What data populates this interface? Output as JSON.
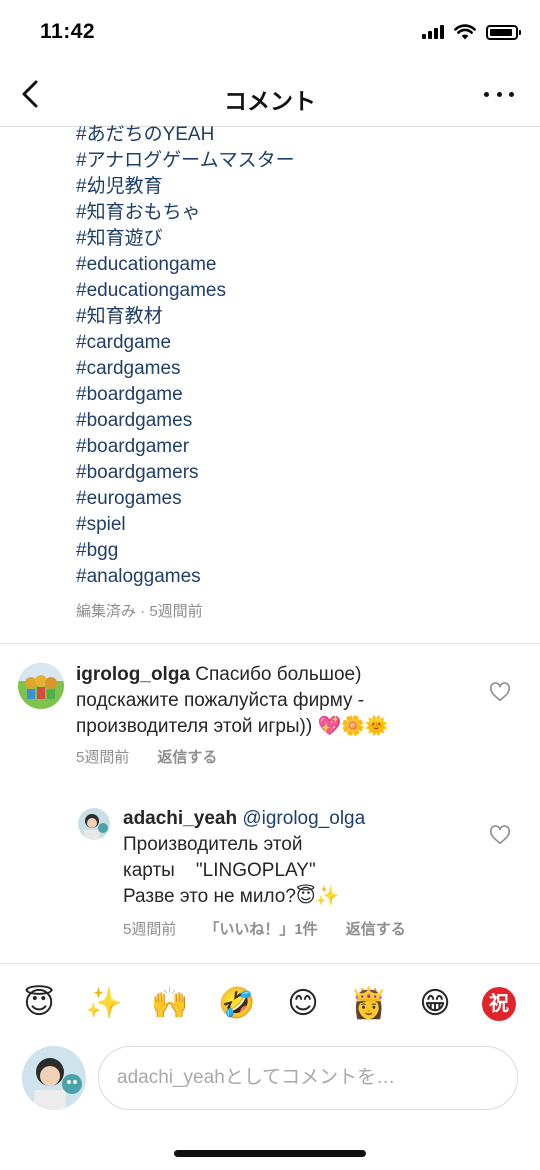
{
  "status_bar": {
    "time": "11:42",
    "battery_level": 0.9
  },
  "header": {
    "title": "コメント",
    "back_icon": "chevron-left-icon",
    "more_icon": "more-horizontal-icon"
  },
  "caption": {
    "hashtags": [
      "#あだちのYEAH",
      "#アナログゲームマスター",
      "#幼児教育",
      "#知育おもちゃ",
      "#知育遊び",
      "#educationgame",
      "#educationgames",
      "#知育教材",
      "#cardgame",
      "#cardgames",
      "#boardgame",
      "#boardgames",
      "#boardgamer",
      "#boardgamers",
      "#eurogames",
      "#spiel",
      "#bgg",
      "#analoggames"
    ],
    "meta": "編集済み · 5週間前"
  },
  "comments": [
    {
      "username": "igrolog_olga",
      "lines": [
        "Спасибо большое)",
        "подскажите пожалуйста фирму -",
        "производителя этой игры))"
      ],
      "emojis": "💖🌼🌞",
      "time": "5週間前",
      "reply_label": "返信する",
      "heart_icon": "heart-outline-icon"
    },
    {
      "username": "adachi_yeah",
      "mention": "@igrolog_olga",
      "lines": [
        "Производитель этой",
        "карты    \"LINGOPLAY\"",
        "Разве это не мило?"
      ],
      "emojis": "😇✨",
      "time": "5週間前",
      "likes": "「いいね！」1件",
      "reply_label": "返信する",
      "heart_icon": "heart-outline-icon"
    }
  ],
  "emoji_bar": [
    "😇",
    "✨",
    "🙌",
    "🤣",
    "😊",
    "👸",
    "😁",
    "祝"
  ],
  "composer": {
    "placeholder": "adachi_yeahとしてコメントを…"
  }
}
